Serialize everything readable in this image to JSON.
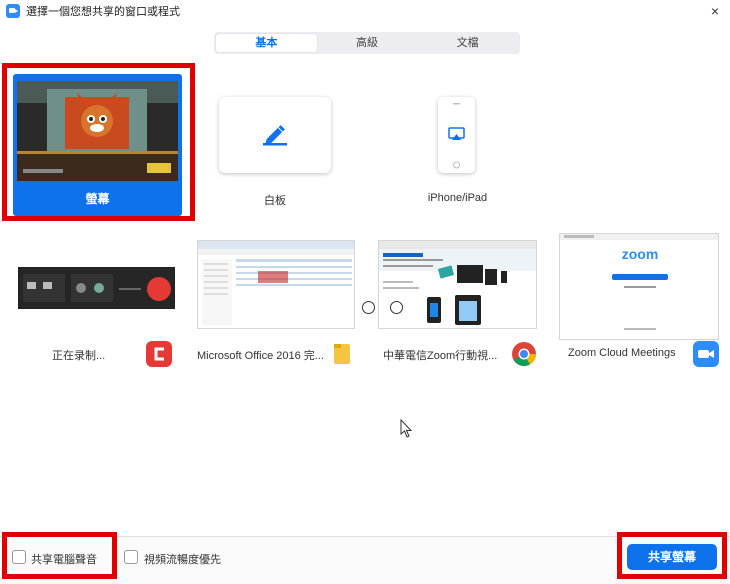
{
  "window": {
    "title": "選擇一個您想共享的窗口或程式",
    "close_label": "×"
  },
  "tabs": [
    {
      "label": "基本",
      "active": true
    },
    {
      "label": "高級",
      "active": false
    },
    {
      "label": "文檔",
      "active": false
    }
  ],
  "share_items": {
    "screen": {
      "label": "螢幕",
      "selected": true
    },
    "whiteboard": {
      "label": "白板"
    },
    "iphone": {
      "label": "iPhone/iPad"
    }
  },
  "windows": [
    {
      "label": "正在录制...",
      "icon": "camtasia-icon",
      "icon_color": "#e53935"
    },
    {
      "label": "Microsoft Office 2016 完...",
      "icon": "folder-icon",
      "icon_color": "#f5c542"
    },
    {
      "label": "中華電信Zoom行動視...",
      "icon": "chrome-icon",
      "icon_color": "#4285f4"
    },
    {
      "label": "Zoom Cloud Meetings",
      "icon": "zoom-icon",
      "icon_color": "#2d8cff"
    }
  ],
  "zoom_preview": {
    "logo_text": "zoom"
  },
  "options": {
    "share_audio": {
      "label": "共享電腦聲音",
      "checked": false
    },
    "optimize_video": {
      "label": "視頻流暢度優先",
      "checked": false
    }
  },
  "share_button": {
    "label": "共享螢幕"
  },
  "colors": {
    "accent": "#0e72ed",
    "highlight": "#e00000"
  }
}
